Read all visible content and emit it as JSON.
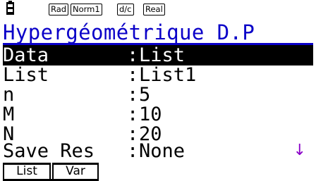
{
  "status_bar": {
    "battery_icon": "battery-icon",
    "angle_mode": "Rad",
    "display_mode": "Norm1",
    "fraction_mode": "d/c",
    "complex_mode": "Real"
  },
  "title": "Hypergéométrique D.P",
  "rows": [
    {
      "label": "Data",
      "colon": ":",
      "value": "List"
    },
    {
      "label": "List",
      "colon": ":",
      "value": "List1"
    },
    {
      "label": "n",
      "colon": ":",
      "value": "5"
    },
    {
      "label": "M",
      "colon": ":",
      "value": "10"
    },
    {
      "label": "N",
      "colon": ":",
      "value": "20"
    },
    {
      "label": "Save Res",
      "colon": ":",
      "value": "None"
    }
  ],
  "scroll_indicator": "↓",
  "function_keys": [
    {
      "label": "List"
    },
    {
      "label": "Var"
    }
  ],
  "colors": {
    "title": "#0a00c8",
    "scroll_arrow": "#8a00c8",
    "selection_bg": "#000000"
  }
}
